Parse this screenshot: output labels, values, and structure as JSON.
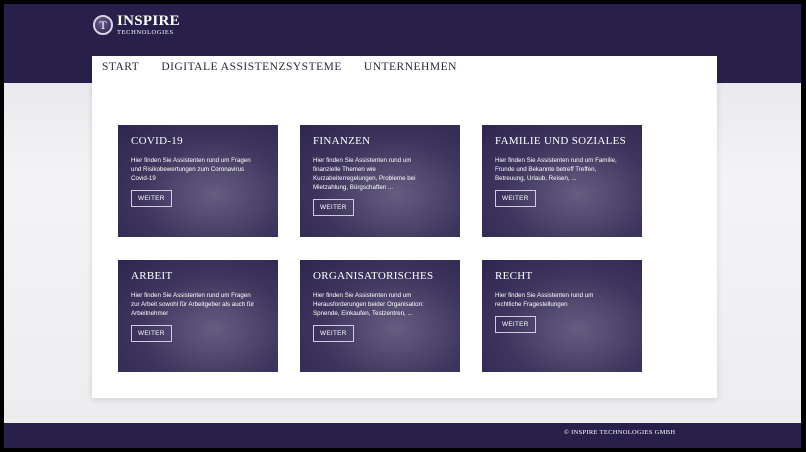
{
  "brand": {
    "name": "INSPIRE",
    "sub": "TECHNOLOGIES",
    "mark": "T"
  },
  "nav": [
    {
      "label": "START"
    },
    {
      "label": "DIGITALE ASSISTENZSYSTEME"
    },
    {
      "label": "UNTERNEHMEN"
    }
  ],
  "cards": [
    {
      "title": "COVID-19",
      "text": "Hier finden Sie Assistenten rund um Fragen und Risikobewertungen zum Coronavirus Covid-19",
      "button": "WEITER"
    },
    {
      "title": "FINANZEN",
      "text": "Hier finden Sie Assistenten rund um finanzielle Themen wie Kurzabeiterregelungen, Probleme bei Mietzahlung, Bürgschaften ...",
      "button": "WEITER"
    },
    {
      "title": "FAMILIE UND SOZIALES",
      "text": "Hier finden Sie Assistenten rund um Familie, Frunde und Bekannte betreff Treffen, Betreuung, Urlaub, Reisen, ...",
      "button": "WEITER"
    },
    {
      "title": "ARBEIT",
      "text": "Hier finden Sie Assistenten rund um Fragen zur Arbeit sowohl für Arbeitgeber als auch für Arbeitnehmer",
      "button": "WEITER"
    },
    {
      "title": "ORGANISATORISCHES",
      "text": "Hier finden Sie Assistenten rund um Herausforderungen beider Organisation: Spnende, Einkaufen, Testzentren, ...",
      "button": "WEITER"
    },
    {
      "title": "RECHT",
      "text": "Hier finden Sie Assistenten rund um rechtliche Fragestellungen",
      "button": "WEITER"
    }
  ],
  "footer": {
    "text": "© INSPIRE TECHNOLOGIES GMBH"
  },
  "colors": {
    "brand_dark": "#28204a",
    "card_center": "#655d80",
    "card_edge": "#2e2650"
  }
}
